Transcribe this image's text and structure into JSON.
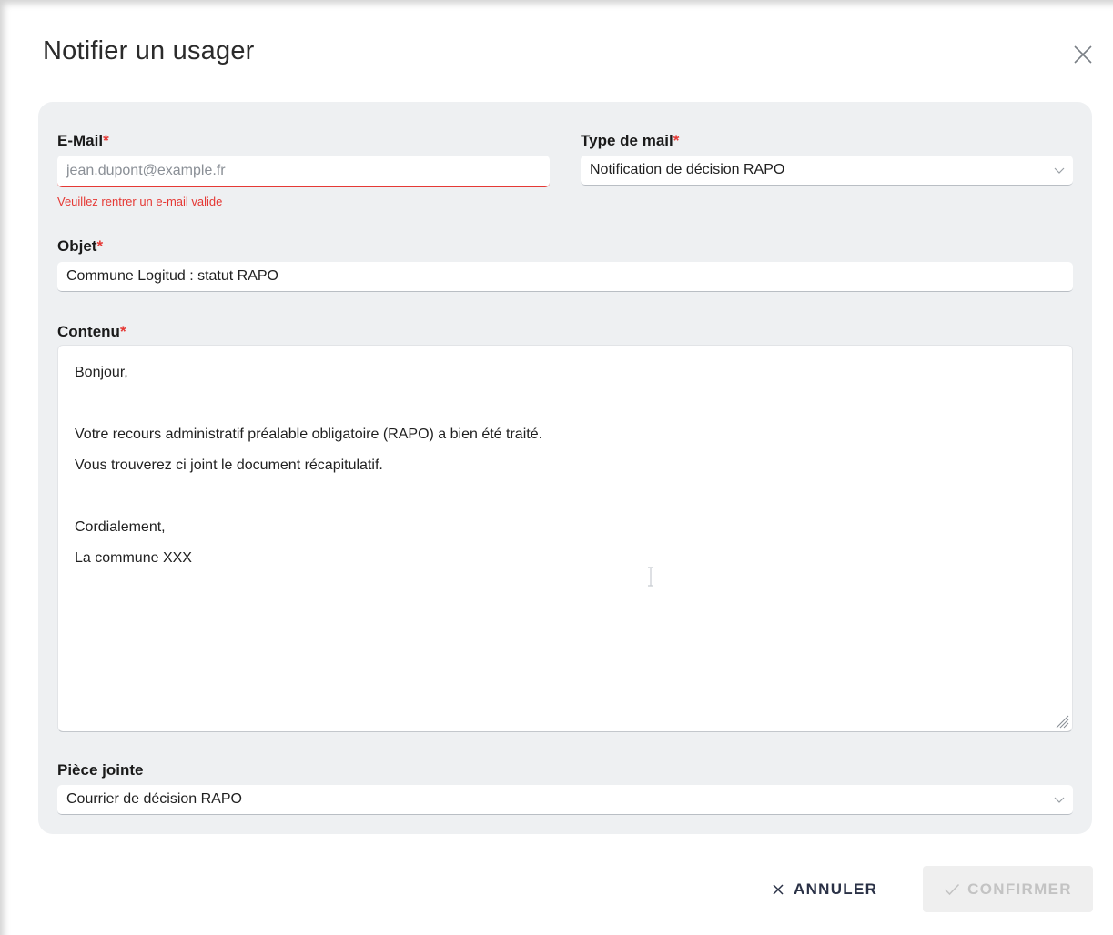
{
  "dialog": {
    "title": "Notifier un usager",
    "close_icon": "close-icon"
  },
  "form": {
    "email": {
      "label": "E-Mail",
      "required_mark": "*",
      "placeholder": "jean.dupont@example.fr",
      "value": "",
      "error": "Veuillez rentrer un e-mail valide"
    },
    "mail_type": {
      "label": "Type de mail",
      "required_mark": "*",
      "selected": "Notification de décision RAPO"
    },
    "subject": {
      "label": "Objet",
      "required_mark": "*",
      "value": "Commune Logitud : statut RAPO"
    },
    "content": {
      "label": "Contenu",
      "required_mark": "*",
      "lines": [
        "Bonjour,",
        "",
        "Votre recours administratif préalable obligatoire (RAPO) a bien été traité.",
        "Vous trouverez ci joint le document récapitulatif.",
        "",
        "Cordialement,",
        "La commune XXX"
      ]
    },
    "attachment": {
      "label": "Pièce jointe",
      "selected": "Courrier de décision RAPO"
    }
  },
  "actions": {
    "cancel_label": "ANNULER",
    "confirm_label": "CONFIRMER"
  },
  "colors": {
    "required": "#e53935",
    "panel_bg": "#eef0f2",
    "cancel_text": "#2a3146",
    "confirm_disabled_bg": "#efefef",
    "confirm_disabled_text": "#c3c3c3"
  }
}
